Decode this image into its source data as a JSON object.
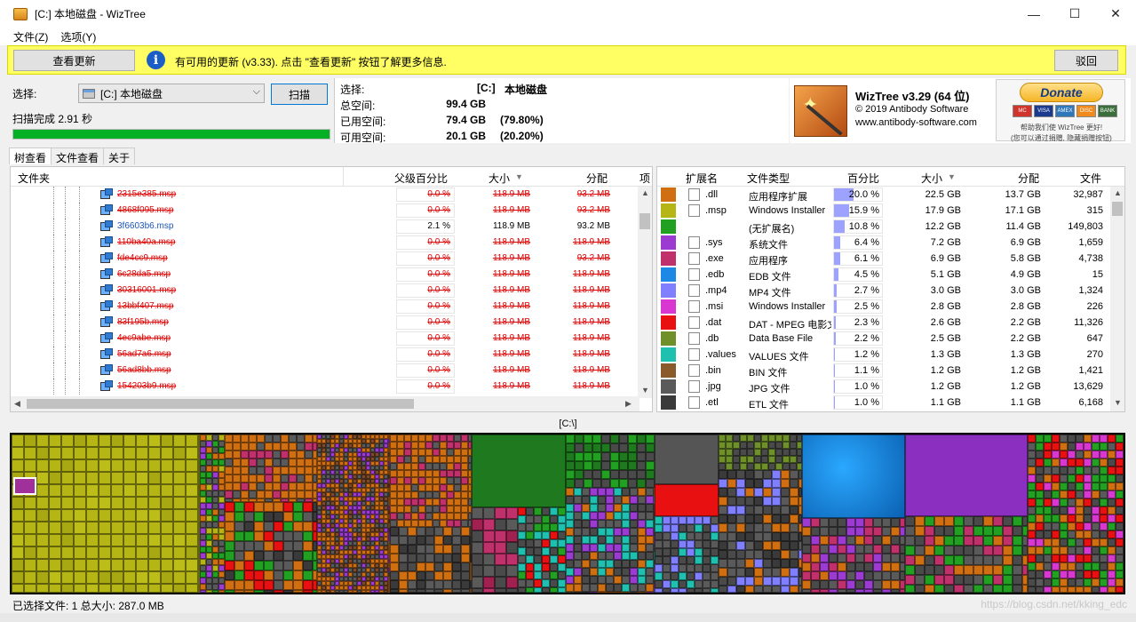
{
  "window": {
    "title": "[C:] 本地磁盘  - WizTree",
    "minimize": "—",
    "maximize": "☐",
    "close": "✕"
  },
  "menu": [
    "文件(Z)",
    "选项(Y)"
  ],
  "update_bar": {
    "check_button": "查看更新",
    "info_icon": "i",
    "message": "有可用的更新 (v3.33). 点击 \"查看更新\" 按钮了解更多信息.",
    "dismiss_button": "驳回"
  },
  "scan": {
    "select_label": "选择:",
    "drive": "[C:] 本地磁盘",
    "scan_button": "扫描",
    "status": "扫描完成 2.91 秒",
    "progress": 1.0
  },
  "disk": {
    "select_label": "选择:",
    "drive_letter": "[C:]",
    "drive_name": "本地磁盘",
    "total_label": "总空间:",
    "total_value": "99.4 GB",
    "used_label": "已用空间:",
    "used_value": "79.4 GB",
    "used_pct": "(79.80%)",
    "free_label": "可用空间:",
    "free_value": "20.1 GB",
    "free_pct": "(20.20%)"
  },
  "brand": {
    "name": "WizTree v3.29 (64 位)",
    "copyright": "© 2019 Antibody Software",
    "url": "www.antibody-software.com",
    "donate": "Donate",
    "donate_text": "帮助我们使 WizTree 更好!",
    "donate_note": "(您可以通过捐赠, 隐藏捐赠按钮)",
    "cards": [
      {
        "label": "MC",
        "color": "#d0342c"
      },
      {
        "label": "VISA",
        "color": "#1a3a8f"
      },
      {
        "label": "AMEX",
        "color": "#2e77bb"
      },
      {
        "label": "DISC",
        "color": "#f08a1c"
      },
      {
        "label": "BANK",
        "color": "#3a6e3a"
      }
    ]
  },
  "tabs": [
    "树查看",
    "文件查看",
    "关于"
  ],
  "tree": {
    "headers": {
      "folder": "文件夹",
      "parent_pct": "父级百分比",
      "size": "大小",
      "alloc": "分配",
      "items": "项"
    },
    "rows": [
      {
        "name": "2315e385.msp",
        "pct": "0.0 %",
        "size": "118.9 MB",
        "alloc": "93.2 MB",
        "state": "deleted"
      },
      {
        "name": "4868f095.msp",
        "pct": "0.0 %",
        "size": "118.9 MB",
        "alloc": "93.2 MB",
        "state": "deleted"
      },
      {
        "name": "3f6603b6.msp",
        "pct": "2.1 %",
        "size": "118.9 MB",
        "alloc": "93.2 MB",
        "state": "normal"
      },
      {
        "name": "110ba40a.msp",
        "pct": "0.0 %",
        "size": "118.9 MB",
        "alloc": "118.9 MB",
        "state": "deleted"
      },
      {
        "name": "fde4cc9.msp",
        "pct": "0.0 %",
        "size": "118.9 MB",
        "alloc": "93.2 MB",
        "state": "deleted"
      },
      {
        "name": "6c28da5.msp",
        "pct": "0.0 %",
        "size": "118.9 MB",
        "alloc": "118.9 MB",
        "state": "deleted"
      },
      {
        "name": "30316001.msp",
        "pct": "0.0 %",
        "size": "118.9 MB",
        "alloc": "118.9 MB",
        "state": "deleted"
      },
      {
        "name": "13bbf407.msp",
        "pct": "0.0 %",
        "size": "118.9 MB",
        "alloc": "118.9 MB",
        "state": "deleted"
      },
      {
        "name": "83f195b.msp",
        "pct": "0.0 %",
        "size": "118.9 MB",
        "alloc": "118.9 MB",
        "state": "deleted"
      },
      {
        "name": "4ec9abe.msp",
        "pct": "0.0 %",
        "size": "118.9 MB",
        "alloc": "118.9 MB",
        "state": "deleted"
      },
      {
        "name": "56ad7a6.msp",
        "pct": "0.0 %",
        "size": "118.9 MB",
        "alloc": "118.9 MB",
        "state": "deleted"
      },
      {
        "name": "56ad8bb.msp",
        "pct": "0.0 %",
        "size": "118.9 MB",
        "alloc": "118.9 MB",
        "state": "deleted"
      },
      {
        "name": "154203b9.msp",
        "pct": "0.0 %",
        "size": "118.9 MB",
        "alloc": "118.9 MB",
        "state": "deleted"
      }
    ]
  },
  "extensions": {
    "headers": {
      "ext": "扩展名",
      "type": "文件类型",
      "pct": "百分比",
      "size": "大小",
      "alloc": "分配",
      "files": "文件"
    },
    "rows": [
      {
        "color": "#cf6f12",
        "ext": ".dll",
        "type": "应用程序扩展",
        "pct": "20.0 %",
        "pct_value": 20.0,
        "size": "22.5 GB",
        "alloc": "13.7 GB",
        "files": "32,987",
        "icon": "gear-file-icon"
      },
      {
        "color": "#b5b515",
        "ext": ".msp",
        "type": "Windows Installer",
        "pct": "15.9 %",
        "pct_value": 15.9,
        "size": "17.9 GB",
        "alloc": "17.1 GB",
        "files": "315",
        "icon": "installer-icon"
      },
      {
        "color": "#22a022",
        "ext": "",
        "type": "(无扩展名)",
        "pct": "10.8 %",
        "pct_value": 10.8,
        "size": "12.2 GB",
        "alloc": "11.4 GB",
        "files": "149,803",
        "icon": ""
      },
      {
        "color": "#9b3bd1",
        "ext": ".sys",
        "type": "系统文件",
        "pct": "6.4 %",
        "pct_value": 6.4,
        "size": "7.2 GB",
        "alloc": "6.9 GB",
        "files": "1,659",
        "icon": "gear-file-icon"
      },
      {
        "color": "#c0306a",
        "ext": ".exe",
        "type": "应用程序",
        "pct": "6.1 %",
        "pct_value": 6.1,
        "size": "6.9 GB",
        "alloc": "5.8 GB",
        "files": "4,738",
        "icon": "window-icon"
      },
      {
        "color": "#1e88e5",
        "ext": ".edb",
        "type": "EDB 文件",
        "pct": "4.5 %",
        "pct_value": 4.5,
        "size": "5.1 GB",
        "alloc": "4.9 GB",
        "files": "15",
        "icon": "file-icon"
      },
      {
        "color": "#7f7fff",
        "ext": ".mp4",
        "type": "MP4 文件",
        "pct": "2.7 %",
        "pct_value": 2.7,
        "size": "3.0 GB",
        "alloc": "3.0 GB",
        "files": "1,324",
        "icon": "media-icon"
      },
      {
        "color": "#d838d0",
        "ext": ".msi",
        "type": "Windows Installer",
        "pct": "2.5 %",
        "pct_value": 2.5,
        "size": "2.8 GB",
        "alloc": "2.8 GB",
        "files": "226",
        "icon": "installer-icon"
      },
      {
        "color": "#e81010",
        "ext": ".dat",
        "type": "DAT - MPEG 电影文件",
        "pct": "2.3 %",
        "pct_value": 2.3,
        "size": "2.6 GB",
        "alloc": "2.2 GB",
        "files": "11,326",
        "icon": "file-icon"
      },
      {
        "color": "#6e8f2a",
        "ext": ".db",
        "type": "Data Base File",
        "pct": "2.2 %",
        "pct_value": 2.2,
        "size": "2.5 GB",
        "alloc": "2.2 GB",
        "files": "647",
        "icon": "gear-file-icon"
      },
      {
        "color": "#20c0b0",
        "ext": ".values",
        "type": "VALUES 文件",
        "pct": "1.2 %",
        "pct_value": 1.2,
        "size": "1.3 GB",
        "alloc": "1.3 GB",
        "files": "270",
        "icon": "file-icon"
      },
      {
        "color": "#8a5a2a",
        "ext": ".bin",
        "type": "BIN 文件",
        "pct": "1.1 %",
        "pct_value": 1.1,
        "size": "1.2 GB",
        "alloc": "1.2 GB",
        "files": "1,421",
        "icon": "file-icon"
      },
      {
        "color": "#5a5a5a",
        "ext": ".jpg",
        "type": "JPG 文件",
        "pct": "1.0 %",
        "pct_value": 1.0,
        "size": "1.2 GB",
        "alloc": "1.2 GB",
        "files": "13,629",
        "icon": "image-icon"
      },
      {
        "color": "#3a3a3a",
        "ext": ".etl",
        "type": "ETL 文件",
        "pct": "1.0 %",
        "pct_value": 1.0,
        "size": "1.1 GB",
        "alloc": "1.1 GB",
        "files": "6,168",
        "icon": "file-icon"
      }
    ]
  },
  "treemap": {
    "path": "[C:\\]"
  },
  "status": {
    "text": "已选择文件: 1   总大小: 287.0 MB",
    "watermark": "https://blog.csdn.net/kking_edc"
  }
}
